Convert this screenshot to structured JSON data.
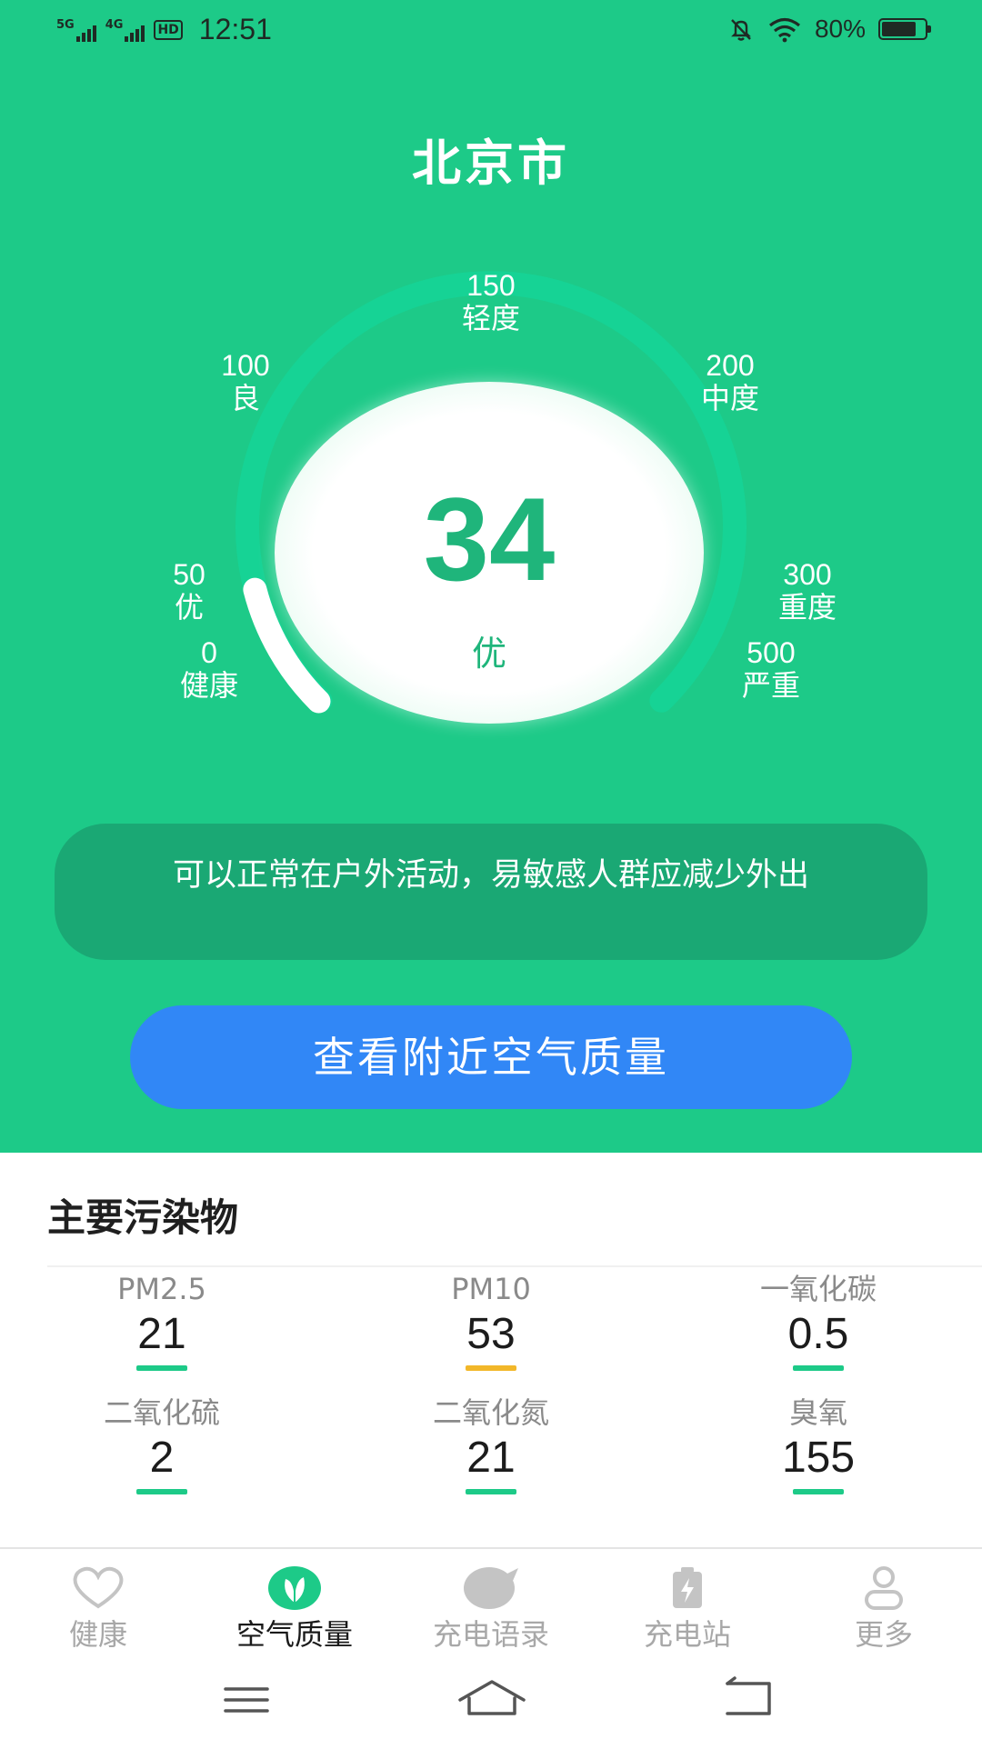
{
  "status_bar": {
    "signal_1": "5G",
    "signal_2": "4G",
    "hd": "HD",
    "time": "12:51",
    "battery_text": "80%",
    "battery_level": 0.8
  },
  "city": "北京市",
  "gauge": {
    "ticks": [
      {
        "value": "0",
        "label": "健康"
      },
      {
        "value": "50",
        "label": "优"
      },
      {
        "value": "100",
        "label": "良"
      },
      {
        "value": "150",
        "label": "轻度"
      },
      {
        "value": "200",
        "label": "中度"
      },
      {
        "value": "300",
        "label": "重度"
      },
      {
        "value": "500",
        "label": "严重"
      }
    ],
    "aqi": "34",
    "level": "优"
  },
  "advice": "可以正常在户外活动，易敏感人群应减少外出",
  "nearby_button": "查看附近空气质量",
  "pollutants": {
    "title": "主要污染物",
    "items": [
      {
        "name": "PM2.5",
        "value": "21",
        "bar_color": "#1dca88"
      },
      {
        "name": "PM10",
        "value": "53",
        "bar_color": "#f2b729"
      },
      {
        "name": "一氧化碳",
        "value": "0.5",
        "bar_color": "#1dca88"
      },
      {
        "name": "二氧化硫",
        "value": "2",
        "bar_color": "#1dca88"
      },
      {
        "name": "二氧化氮",
        "value": "21",
        "bar_color": "#1dca88"
      },
      {
        "name": "臭氧",
        "value": "155",
        "bar_color": "#1dca88"
      }
    ]
  },
  "tabs": [
    {
      "label": "健康",
      "icon": "heart-icon",
      "active": false
    },
    {
      "label": "空气质量",
      "icon": "leaf-icon",
      "active": true
    },
    {
      "label": "充电语录",
      "icon": "chat-bubble-icon",
      "active": false
    },
    {
      "label": "充电站",
      "icon": "battery-charge-icon",
      "active": false
    },
    {
      "label": "更多",
      "icon": "user-icon",
      "active": false
    }
  ],
  "colors": {
    "primary_green": "#1dca88",
    "dark_green": "#1aa874",
    "button_blue": "#3187f6",
    "warn_yellow": "#f2b729"
  }
}
